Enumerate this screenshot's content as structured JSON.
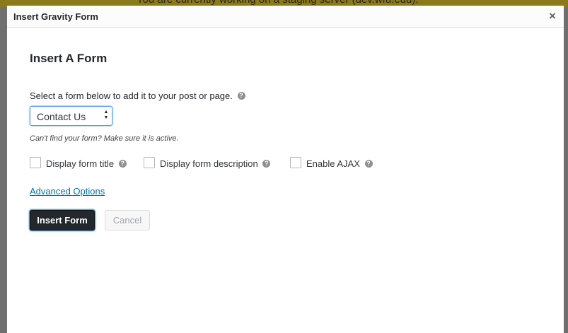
{
  "background": {
    "banner_text": "You are currently working on a staging server (dev.wfu.edu)."
  },
  "modal": {
    "title": "Insert Gravity Form",
    "close_glyph": "×"
  },
  "form": {
    "heading": "Insert A Form",
    "instruction": "Select a form below to add it to your post or page.",
    "help_glyph": "?",
    "select": {
      "selected": "Contact Us",
      "arrows_up": "▲",
      "arrows_down": "▼"
    },
    "note": "Can't find your form? Make sure it is active.",
    "options": {
      "display_title": "Display form title",
      "display_description": "Display form description",
      "enable_ajax": "Enable AJAX"
    },
    "advanced_link": "Advanced Options",
    "buttons": {
      "insert": "Insert Form",
      "cancel": "Cancel"
    }
  },
  "colors": {
    "primary_button": "#23282d",
    "link": "#0073aa",
    "focus": "#5b9dd9"
  },
  "icons": [
    "close-icon",
    "help-icon",
    "select-arrows-icon",
    "checkbox-icon"
  ]
}
